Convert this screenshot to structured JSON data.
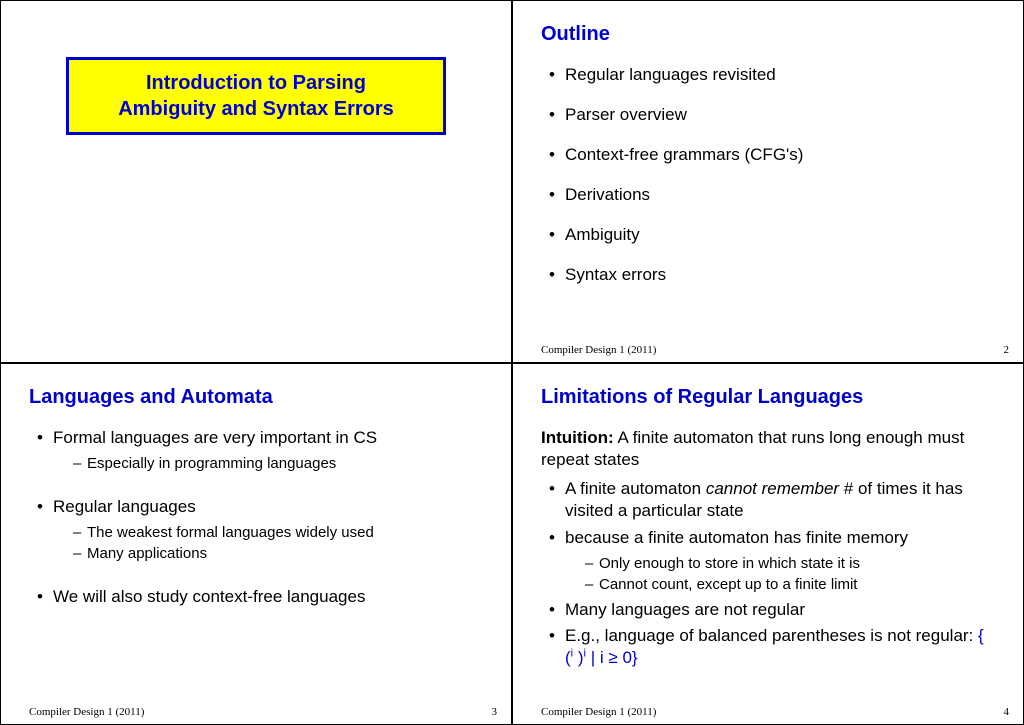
{
  "footer": "Compiler Design 1 (2011)",
  "slide1": {
    "title_line1": "Introduction to Parsing",
    "title_line2": "Ambiguity and Syntax Errors"
  },
  "slide2": {
    "heading": "Outline",
    "items": [
      "Regular languages revisited",
      "Parser overview",
      "Context-free grammars (CFG's)",
      "Derivations",
      "Ambiguity",
      "Syntax errors"
    ],
    "page": "2"
  },
  "slide3": {
    "heading": "Languages and Automata",
    "b1": "Formal languages are very important in CS",
    "b1s1": "Especially in programming languages",
    "b2": "Regular languages",
    "b2s1": "The weakest formal languages widely used",
    "b2s2": "Many applications",
    "b3": "We will also study context-free languages",
    "page": "3"
  },
  "slide4": {
    "heading": "Limitations of Regular Languages",
    "intuition_label": "Intuition:",
    "intuition_text": " A finite automaton that runs long enough must repeat states",
    "b1a": "A finite automaton ",
    "b1b": "cannot remember",
    "b1c": " # of times it has visited a particular state",
    "b2": "because a finite automaton has finite memory",
    "b2s1": "Only enough to store in which state it is",
    "b2s2": "Cannot count, except up to a finite limit",
    "b3": "Many languages are not regular",
    "b4a": "E.g., language of balanced parentheses is not regular: ",
    "b4b_open": "{ (",
    "b4b_i1": "i",
    "b4b_mid": " )",
    "b4b_i2": "i",
    "b4b_bar": " | i ",
    "b4b_geq": "≥",
    "b4b_close": " 0}",
    "page": "4"
  }
}
